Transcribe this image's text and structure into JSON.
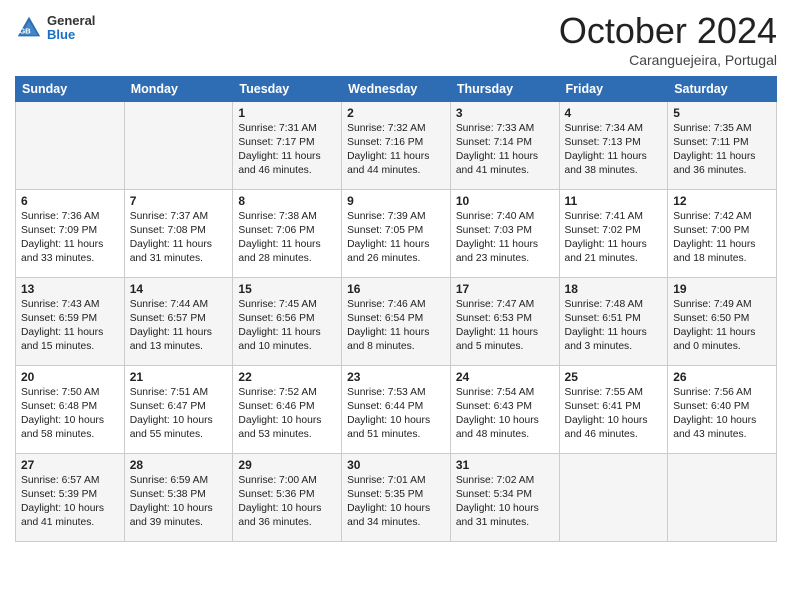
{
  "logo": {
    "general": "General",
    "blue": "Blue"
  },
  "title": "October 2024",
  "subtitle": "Caranguejeira, Portugal",
  "days_of_week": [
    "Sunday",
    "Monday",
    "Tuesday",
    "Wednesday",
    "Thursday",
    "Friday",
    "Saturday"
  ],
  "weeks": [
    [
      {
        "day": "",
        "sunrise": "",
        "sunset": "",
        "daylight": ""
      },
      {
        "day": "",
        "sunrise": "",
        "sunset": "",
        "daylight": ""
      },
      {
        "day": "1",
        "sunrise": "Sunrise: 7:31 AM",
        "sunset": "Sunset: 7:17 PM",
        "daylight": "Daylight: 11 hours and 46 minutes."
      },
      {
        "day": "2",
        "sunrise": "Sunrise: 7:32 AM",
        "sunset": "Sunset: 7:16 PM",
        "daylight": "Daylight: 11 hours and 44 minutes."
      },
      {
        "day": "3",
        "sunrise": "Sunrise: 7:33 AM",
        "sunset": "Sunset: 7:14 PM",
        "daylight": "Daylight: 11 hours and 41 minutes."
      },
      {
        "day": "4",
        "sunrise": "Sunrise: 7:34 AM",
        "sunset": "Sunset: 7:13 PM",
        "daylight": "Daylight: 11 hours and 38 minutes."
      },
      {
        "day": "5",
        "sunrise": "Sunrise: 7:35 AM",
        "sunset": "Sunset: 7:11 PM",
        "daylight": "Daylight: 11 hours and 36 minutes."
      }
    ],
    [
      {
        "day": "6",
        "sunrise": "Sunrise: 7:36 AM",
        "sunset": "Sunset: 7:09 PM",
        "daylight": "Daylight: 11 hours and 33 minutes."
      },
      {
        "day": "7",
        "sunrise": "Sunrise: 7:37 AM",
        "sunset": "Sunset: 7:08 PM",
        "daylight": "Daylight: 11 hours and 31 minutes."
      },
      {
        "day": "8",
        "sunrise": "Sunrise: 7:38 AM",
        "sunset": "Sunset: 7:06 PM",
        "daylight": "Daylight: 11 hours and 28 minutes."
      },
      {
        "day": "9",
        "sunrise": "Sunrise: 7:39 AM",
        "sunset": "Sunset: 7:05 PM",
        "daylight": "Daylight: 11 hours and 26 minutes."
      },
      {
        "day": "10",
        "sunrise": "Sunrise: 7:40 AM",
        "sunset": "Sunset: 7:03 PM",
        "daylight": "Daylight: 11 hours and 23 minutes."
      },
      {
        "day": "11",
        "sunrise": "Sunrise: 7:41 AM",
        "sunset": "Sunset: 7:02 PM",
        "daylight": "Daylight: 11 hours and 21 minutes."
      },
      {
        "day": "12",
        "sunrise": "Sunrise: 7:42 AM",
        "sunset": "Sunset: 7:00 PM",
        "daylight": "Daylight: 11 hours and 18 minutes."
      }
    ],
    [
      {
        "day": "13",
        "sunrise": "Sunrise: 7:43 AM",
        "sunset": "Sunset: 6:59 PM",
        "daylight": "Daylight: 11 hours and 15 minutes."
      },
      {
        "day": "14",
        "sunrise": "Sunrise: 7:44 AM",
        "sunset": "Sunset: 6:57 PM",
        "daylight": "Daylight: 11 hours and 13 minutes."
      },
      {
        "day": "15",
        "sunrise": "Sunrise: 7:45 AM",
        "sunset": "Sunset: 6:56 PM",
        "daylight": "Daylight: 11 hours and 10 minutes."
      },
      {
        "day": "16",
        "sunrise": "Sunrise: 7:46 AM",
        "sunset": "Sunset: 6:54 PM",
        "daylight": "Daylight: 11 hours and 8 minutes."
      },
      {
        "day": "17",
        "sunrise": "Sunrise: 7:47 AM",
        "sunset": "Sunset: 6:53 PM",
        "daylight": "Daylight: 11 hours and 5 minutes."
      },
      {
        "day": "18",
        "sunrise": "Sunrise: 7:48 AM",
        "sunset": "Sunset: 6:51 PM",
        "daylight": "Daylight: 11 hours and 3 minutes."
      },
      {
        "day": "19",
        "sunrise": "Sunrise: 7:49 AM",
        "sunset": "Sunset: 6:50 PM",
        "daylight": "Daylight: 11 hours and 0 minutes."
      }
    ],
    [
      {
        "day": "20",
        "sunrise": "Sunrise: 7:50 AM",
        "sunset": "Sunset: 6:48 PM",
        "daylight": "Daylight: 10 hours and 58 minutes."
      },
      {
        "day": "21",
        "sunrise": "Sunrise: 7:51 AM",
        "sunset": "Sunset: 6:47 PM",
        "daylight": "Daylight: 10 hours and 55 minutes."
      },
      {
        "day": "22",
        "sunrise": "Sunrise: 7:52 AM",
        "sunset": "Sunset: 6:46 PM",
        "daylight": "Daylight: 10 hours and 53 minutes."
      },
      {
        "day": "23",
        "sunrise": "Sunrise: 7:53 AM",
        "sunset": "Sunset: 6:44 PM",
        "daylight": "Daylight: 10 hours and 51 minutes."
      },
      {
        "day": "24",
        "sunrise": "Sunrise: 7:54 AM",
        "sunset": "Sunset: 6:43 PM",
        "daylight": "Daylight: 10 hours and 48 minutes."
      },
      {
        "day": "25",
        "sunrise": "Sunrise: 7:55 AM",
        "sunset": "Sunset: 6:41 PM",
        "daylight": "Daylight: 10 hours and 46 minutes."
      },
      {
        "day": "26",
        "sunrise": "Sunrise: 7:56 AM",
        "sunset": "Sunset: 6:40 PM",
        "daylight": "Daylight: 10 hours and 43 minutes."
      }
    ],
    [
      {
        "day": "27",
        "sunrise": "Sunrise: 6:57 AM",
        "sunset": "Sunset: 5:39 PM",
        "daylight": "Daylight: 10 hours and 41 minutes."
      },
      {
        "day": "28",
        "sunrise": "Sunrise: 6:59 AM",
        "sunset": "Sunset: 5:38 PM",
        "daylight": "Daylight: 10 hours and 39 minutes."
      },
      {
        "day": "29",
        "sunrise": "Sunrise: 7:00 AM",
        "sunset": "Sunset: 5:36 PM",
        "daylight": "Daylight: 10 hours and 36 minutes."
      },
      {
        "day": "30",
        "sunrise": "Sunrise: 7:01 AM",
        "sunset": "Sunset: 5:35 PM",
        "daylight": "Daylight: 10 hours and 34 minutes."
      },
      {
        "day": "31",
        "sunrise": "Sunrise: 7:02 AM",
        "sunset": "Sunset: 5:34 PM",
        "daylight": "Daylight: 10 hours and 31 minutes."
      },
      {
        "day": "",
        "sunrise": "",
        "sunset": "",
        "daylight": ""
      },
      {
        "day": "",
        "sunrise": "",
        "sunset": "",
        "daylight": ""
      }
    ]
  ]
}
